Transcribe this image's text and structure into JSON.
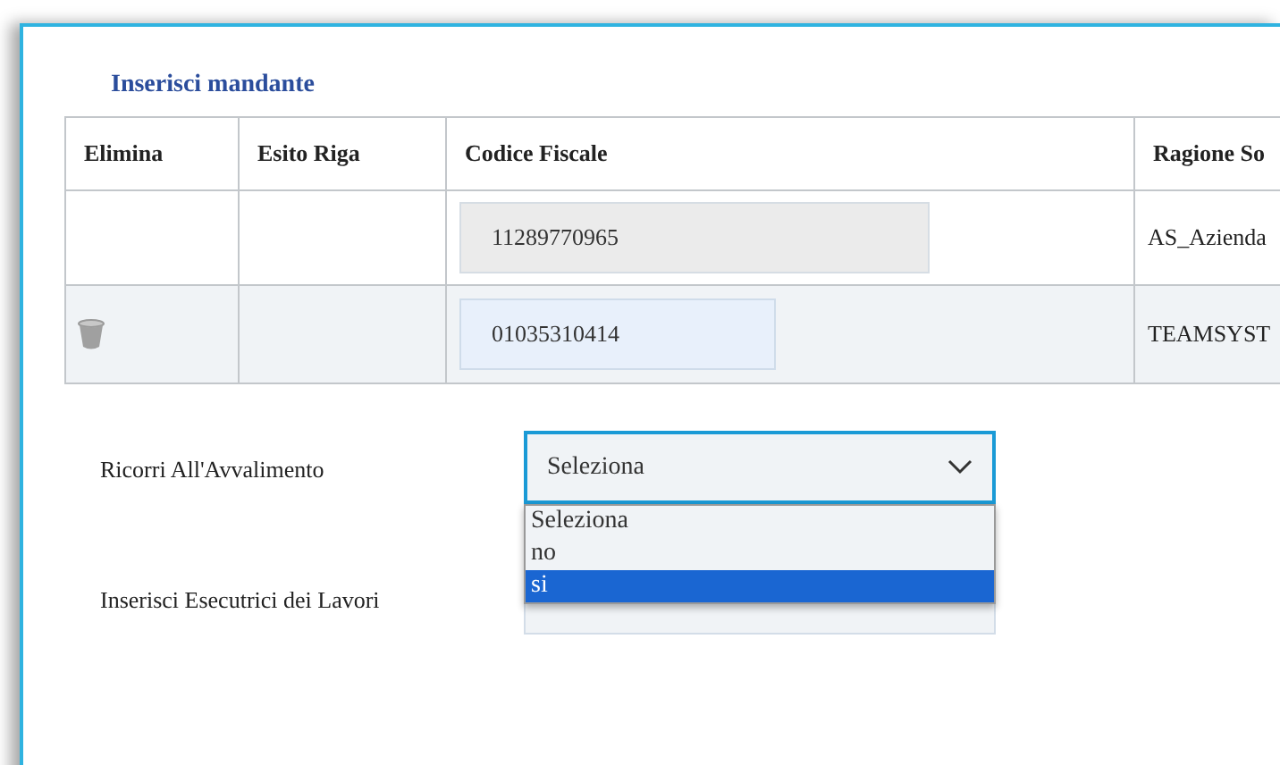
{
  "section_title": "Inserisci mandante",
  "table": {
    "columns": [
      "Elimina",
      "Esito Riga",
      "Codice Fiscale",
      "Ragione So"
    ],
    "rows": [
      {
        "deletable": false,
        "codice_fiscale": {
          "value": "11289770965",
          "disabled": true
        },
        "ragione_sociale": "AS_Azienda"
      },
      {
        "deletable": true,
        "codice_fiscale": {
          "value": "01035310414",
          "disabled": false
        },
        "ragione_sociale": "TEAMSYST"
      }
    ]
  },
  "form": [
    {
      "kind": "select",
      "label": "Ricorri All'Avvalimento",
      "value": "Seleziona",
      "expanded": true,
      "options": [
        {
          "label": "Seleziona",
          "highlighted": false
        },
        {
          "label": "no",
          "highlighted": false
        },
        {
          "label": "si",
          "highlighted": true
        }
      ]
    },
    {
      "kind": "select",
      "label": "Inserisci Esecutrici dei Lavori",
      "expanded": false
    }
  ]
}
